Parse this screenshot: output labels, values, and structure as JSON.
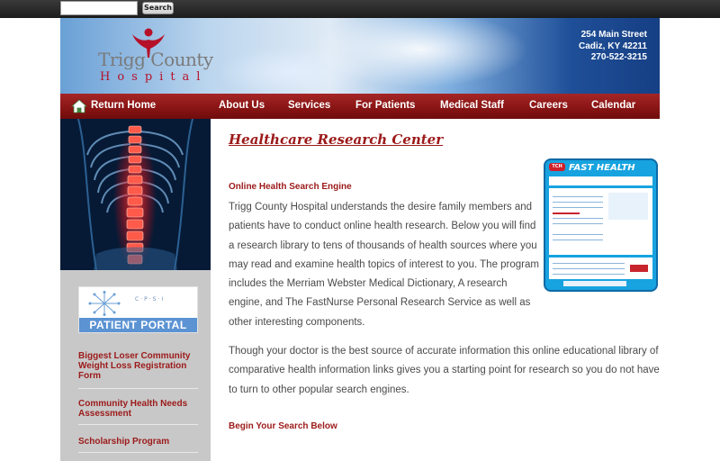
{
  "search": {
    "placeholder": "",
    "button_label": "Search"
  },
  "header": {
    "logo_line1": "Trigg County",
    "logo_line2": "Hospital",
    "address": [
      "254 Main Street",
      "Cadiz, KY 42211",
      "270-522-3215"
    ]
  },
  "nav": {
    "home_label": "Return Home",
    "items": [
      "About Us",
      "Services",
      "For Patients",
      "Medical Staff",
      "Careers",
      "Calendar"
    ]
  },
  "sidebar": {
    "portal_letters": "C·P·S·I",
    "portal_label": "PATIENT PORTAL",
    "links": [
      "Biggest Loser Community Weight Loss Registration Form",
      "Community Health Needs Assessment",
      "Scholarship Program"
    ]
  },
  "main": {
    "title": "Healthcare Research Center",
    "section1_heading": "Online Health Search Engine",
    "para1": "Trigg County Hospital understands the desire family members and patients have to conduct online health research. Below you will find a research library to tens of thousands of health sources where you may read and examine health topics of interest to you. The program includes the Merriam Webster Medical Dictionary, A research engine, and The FastNurse Personal Research Service as well as other interesting components.",
    "para2": "Though your doctor is the best source of accurate information this online educational library of comparative health information links gives you a starting point for research so you do not have to turn to other popular search engines.",
    "section2_heading": "Begin Your Search Below"
  },
  "widget": {
    "badge": "TCH",
    "title": "FAST HEALTH"
  },
  "colors": {
    "brand_red": "#9c1a1a",
    "nav_red": "#8a1515",
    "widget_blue": "#17a3df",
    "portal_blue": "#5b93d3"
  }
}
